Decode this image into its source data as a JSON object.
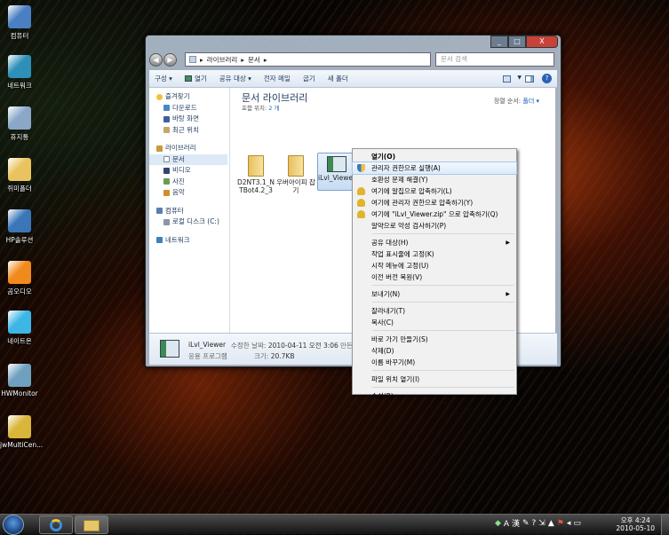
{
  "desktop": {
    "icons": [
      {
        "label": "컴퓨터",
        "color": "#4a7fc1"
      },
      {
        "label": "네트워크",
        "color": "#2e8fb8"
      },
      {
        "label": "휴지통",
        "color": "#8aa7c8"
      },
      {
        "label": "쥐미폴더",
        "color": "#e9c35d"
      },
      {
        "label": "HP솔루션",
        "color": "#3a76b8"
      },
      {
        "label": "곰오디오",
        "color": "#f08a1c"
      },
      {
        "label": "네이트온",
        "color": "#3db6e6"
      },
      {
        "label": "HWMonitor",
        "color": "#6fa0c0"
      },
      {
        "label": "jwMultiCen...",
        "color": "#d9b53a"
      }
    ]
  },
  "window": {
    "caption_buttons": [
      "_",
      "□",
      "X"
    ],
    "breadcrumb": [
      "라이브러리",
      "문서"
    ],
    "search_placeholder": "문서 검색",
    "toolbar": [
      "구성 ▾",
      "열기",
      "공유 대상 ▾",
      "전자 메일",
      "굽기",
      "새 폴더"
    ],
    "nav": {
      "favorites_header": "즐겨찾기",
      "favorites": [
        "다운로드",
        "바탕 화면",
        "최근 위치"
      ],
      "libraries_header": "라이브러리",
      "libraries": [
        "문서",
        "비디오",
        "사진",
        "음악"
      ],
      "computer_header": "컴퓨터",
      "computer": [
        "로컬 디스크 (C:)"
      ],
      "network": "네트워크"
    },
    "library_title": "문서 라이브러리",
    "include_label": "포함 위치:",
    "include_count": "2 개",
    "sort_label": "정렬 순서:",
    "sort_value": "폴더 ▾",
    "files": [
      {
        "name": "D2NT3.1_NTBot4.2_3",
        "kind": "folder"
      },
      {
        "name": "우버아이피 잡기",
        "kind": "folder"
      },
      {
        "name": "iLvl_Viewer",
        "kind": "app"
      }
    ],
    "details": {
      "name": "iLvl_Viewer",
      "type": "응용 프로그램",
      "modified_label": "수정한 날짜:",
      "modified": "2010-04-11 오전 3:06",
      "created_short": "만든",
      "size_label": "크기:",
      "size": "20.7KB"
    }
  },
  "context_menu": {
    "groups": [
      [
        {
          "label": "열기(O)",
          "bold": true,
          "icon": ""
        },
        {
          "label": "관리자 권한으로 실행(A)",
          "icon": "shield",
          "hl": true
        },
        {
          "label": "호환성 문제 해결(Y)",
          "icon": ""
        },
        {
          "label": "여기에 알집으로 압축하기(L)",
          "icon": "zip"
        },
        {
          "label": "여기에 관리자 권한으로 압축하기(Y)",
          "icon": "zip"
        },
        {
          "label": "여기에 \"iLvl_Viewer.zip\" 으로 압축하기(Q)",
          "icon": "zip"
        },
        {
          "label": "알약으로 악성 검사하기(P)",
          "icon": ""
        }
      ],
      [
        {
          "label": "공유 대상(H)",
          "icon": "",
          "sub": true
        },
        {
          "label": "작업 표시줄에 고정(K)",
          "icon": ""
        },
        {
          "label": "시작 메뉴에 고정(U)",
          "icon": ""
        },
        {
          "label": "이전 버전 복원(V)",
          "icon": ""
        }
      ],
      [
        {
          "label": "보내기(N)",
          "icon": "",
          "sub": true
        }
      ],
      [
        {
          "label": "잘라내기(T)",
          "icon": ""
        },
        {
          "label": "복사(C)",
          "icon": ""
        }
      ],
      [
        {
          "label": "바로 가기 만들기(S)",
          "icon": ""
        },
        {
          "label": "삭제(D)",
          "icon": ""
        },
        {
          "label": "이름 바꾸기(M)",
          "icon": ""
        }
      ],
      [
        {
          "label": "파일 위치 열기(I)",
          "icon": ""
        }
      ],
      [
        {
          "label": "속성(R)",
          "icon": ""
        }
      ]
    ]
  },
  "taskbar": {
    "tray_lang": "A 漢",
    "time": "오후 4:24",
    "date": "2010-05-10"
  }
}
